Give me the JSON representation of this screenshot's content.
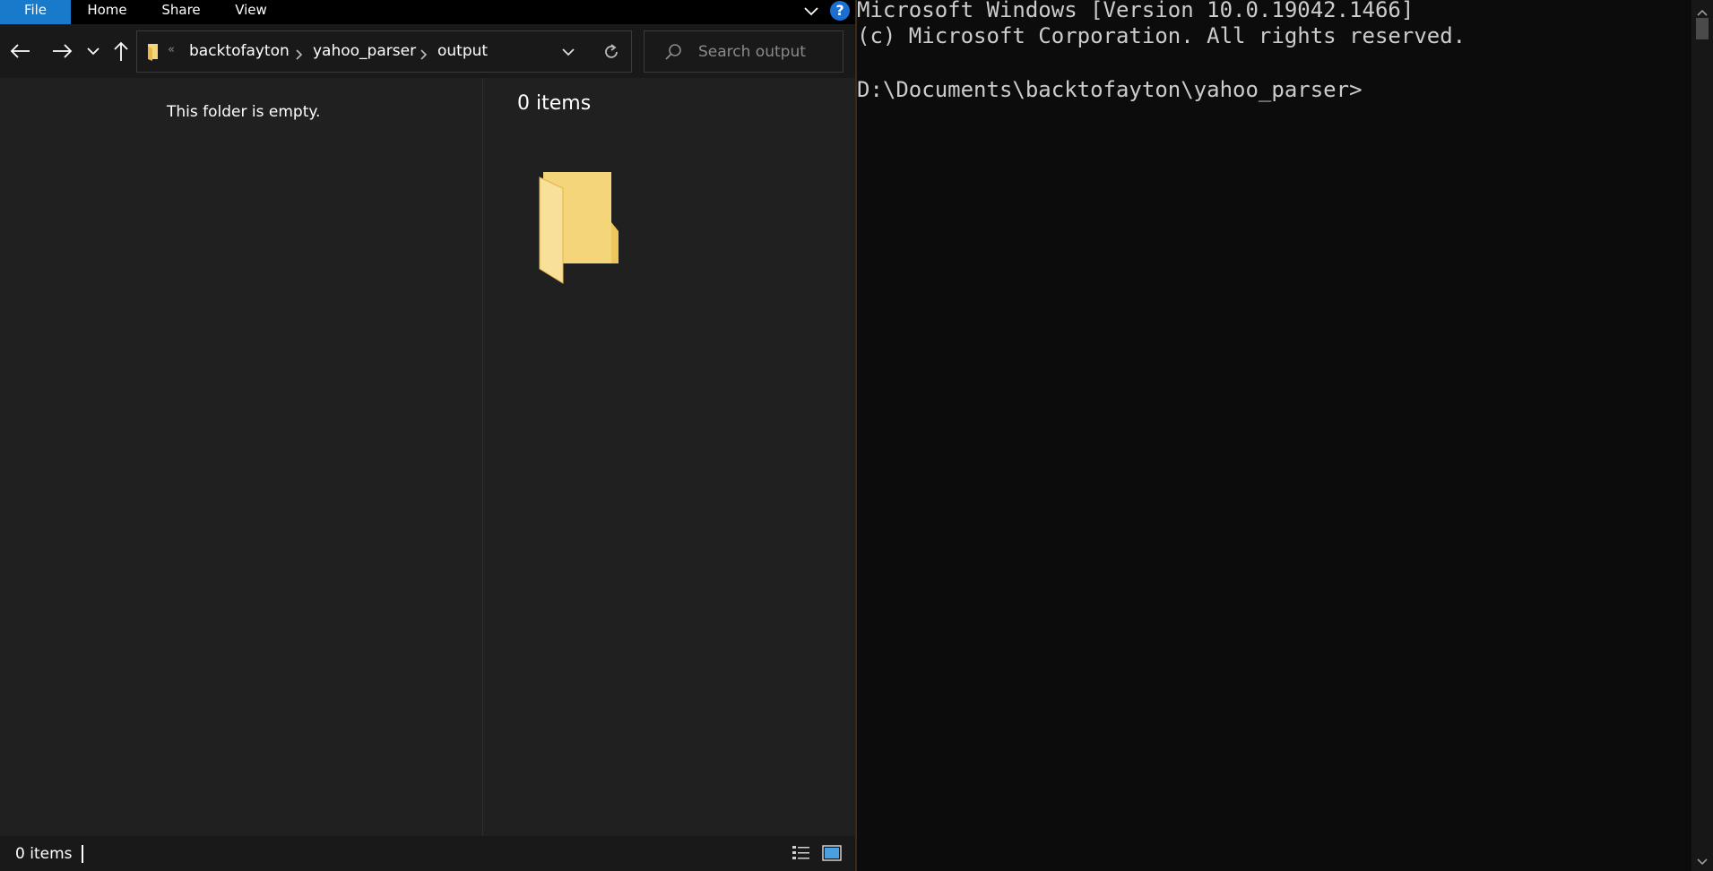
{
  "explorer": {
    "ribbon": {
      "tabs": [
        "File",
        "Home",
        "Share",
        "View"
      ],
      "help_label": "?"
    },
    "address": {
      "overflow": "«",
      "crumbs": [
        "backtofayton",
        "yahoo_parser",
        "output"
      ]
    },
    "search": {
      "placeholder": "Search output"
    },
    "preview": {
      "empty_message": "This folder is empty."
    },
    "content": {
      "item_count_label": "0 items"
    },
    "status": {
      "item_count": "0 items"
    }
  },
  "terminal": {
    "lines": [
      "Microsoft Windows [Version 10.0.19042.1466]",
      "(c) Microsoft Corporation. All rights reserved.",
      "D:\\Documents\\backtofayton\\yahoo_parser>"
    ]
  },
  "colors": {
    "explorer_bg": "#202020",
    "ribbon_bg": "#000000",
    "file_tab_accent": "#1979ca",
    "terminal_bg": "#0c0c0c",
    "terminal_text": "#cccccc",
    "folder_yellow": "#f5d57a"
  }
}
